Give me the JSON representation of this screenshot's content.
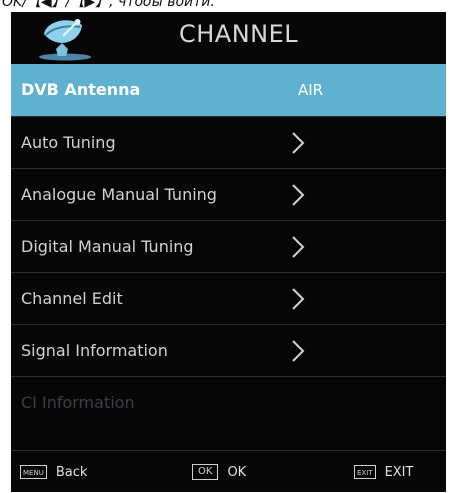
{
  "caption": {
    "text": "OK/【◀】/【▶】, чтобы войти."
  },
  "header": {
    "icon": "satellite-dish-icon",
    "title": "CHANNEL"
  },
  "menu": {
    "items": [
      {
        "label": "DVB Antenna",
        "value": "AIR",
        "state": "selected",
        "arrow": false
      },
      {
        "label": "Auto Tuning",
        "state": "normal",
        "arrow": true
      },
      {
        "label": "Analogue Manual Tuning",
        "state": "normal",
        "arrow": true
      },
      {
        "label": "Digital Manual Tuning",
        "state": "normal",
        "arrow": true
      },
      {
        "label": "Channel Edit",
        "state": "normal",
        "arrow": true
      },
      {
        "label": "Signal Information",
        "state": "normal",
        "arrow": true
      },
      {
        "label": "CI Information",
        "state": "disabled",
        "arrow": false
      }
    ]
  },
  "footer": {
    "menu_key": "MENU",
    "back_label": "Back",
    "ok_key": "OK",
    "ok_label": "OK",
    "exit_key": "EXIT",
    "exit_label": "EXIT"
  },
  "colors": {
    "panel_bg": "#070707",
    "highlight": "#5fb2cf",
    "text": "#d2d2d2",
    "disabled_text": "#3b3f44"
  }
}
